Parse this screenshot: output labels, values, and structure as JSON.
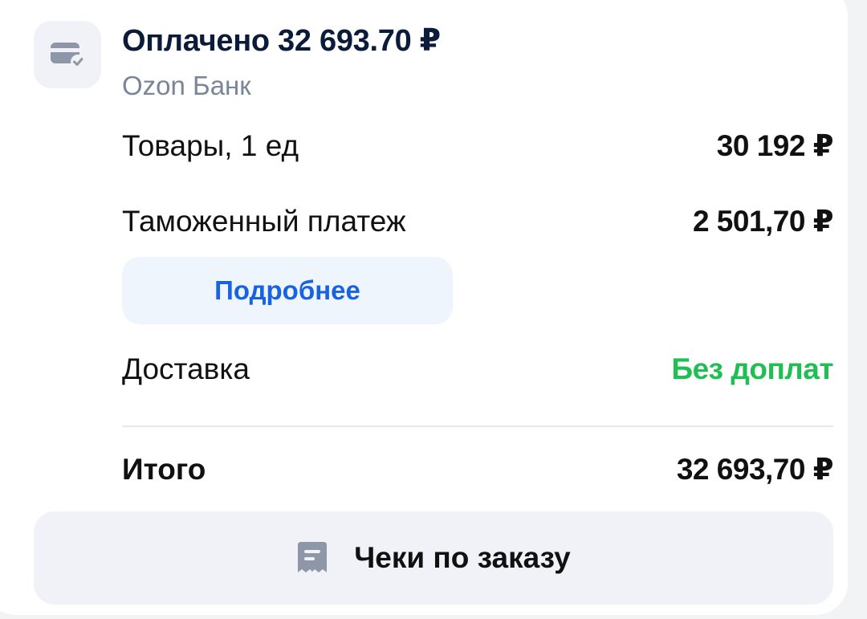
{
  "payment": {
    "icon": "card-check-icon",
    "title": "Оплачено 32 693.70 ₽",
    "bank": "Ozon Банк"
  },
  "rows": {
    "goods": {
      "label": "Товары, 1 ед",
      "value": "30 192 ₽"
    },
    "customs": {
      "label": "Таможенный платеж",
      "value": "2 501,70 ₽"
    },
    "delivery": {
      "label": "Доставка",
      "value": "Без доплат"
    },
    "total": {
      "label": "Итого",
      "value": "32 693,70 ₽"
    }
  },
  "details_button": {
    "label": "Подробнее"
  },
  "receipts_button": {
    "icon": "receipt-icon",
    "label": "Чеки по заказу"
  },
  "colors": {
    "accent": "#1a63e0",
    "success": "#1fbf53",
    "heading": "#0b1b3a",
    "muted": "#7a8598",
    "icon": "#8e97a8"
  }
}
